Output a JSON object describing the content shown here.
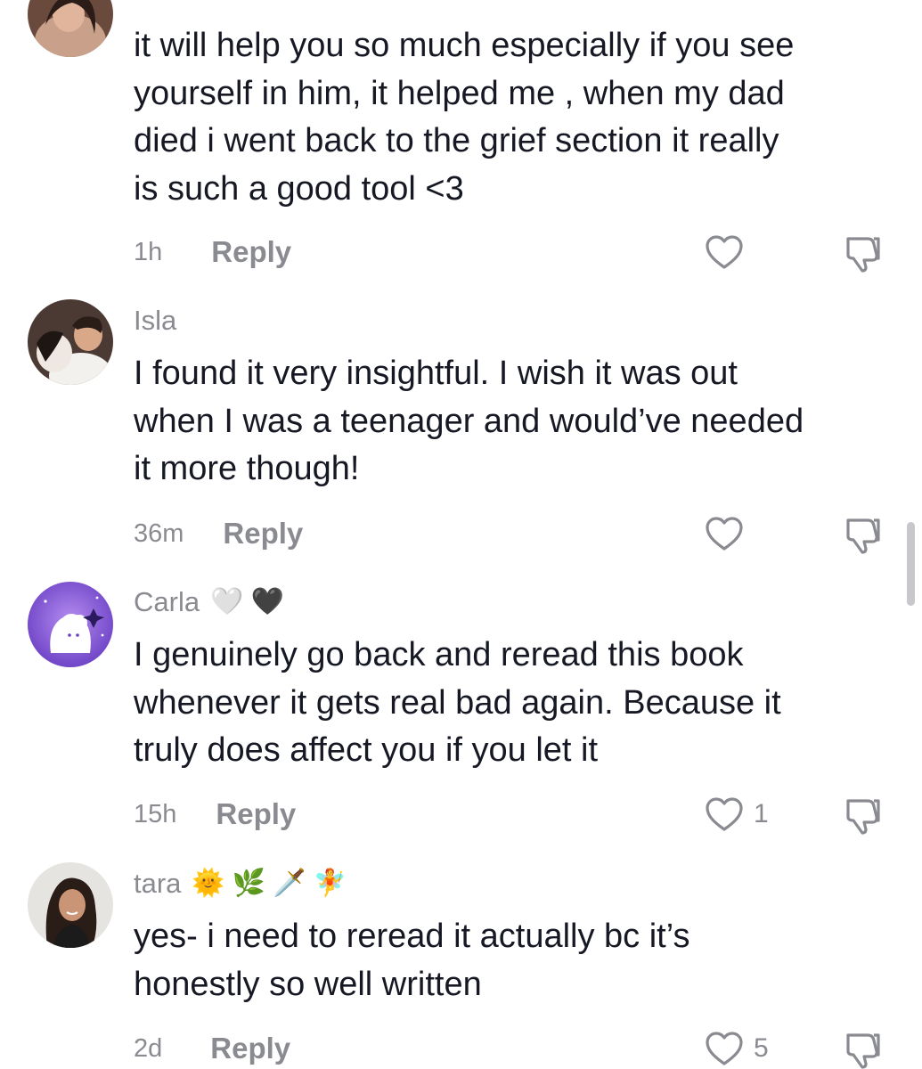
{
  "comments": [
    {
      "username": "",
      "emojis": [],
      "lines": [
        "it will help you so much especially if you see",
        "yourself in him, it helped me , when my dad",
        "died i went back to the grief section it really",
        "is such a good tool <3"
      ],
      "time": "1h",
      "reply_label": "Reply",
      "likes": "",
      "avatar_icon": "profile-photo"
    },
    {
      "username": "Isla",
      "emojis": [],
      "lines": [
        "I found it very insightful. I wish it was out",
        "when I was a teenager and would’ve needed",
        "it more though!"
      ],
      "time": "36m",
      "reply_label": "Reply",
      "likes": "",
      "avatar_icon": "profile-photo"
    },
    {
      "username": "Carla",
      "emojis": [
        "🤍",
        "🖤"
      ],
      "lines": [
        "I genuinely go back and reread this book",
        "whenever it gets real bad again. Because it",
        "truly does affect you if you let it"
      ],
      "time": "15h",
      "reply_label": "Reply",
      "likes": "1",
      "avatar_icon": "cartoon-avatar"
    },
    {
      "username": "tara",
      "emojis": [
        "🌞",
        "🌿",
        "🗡️",
        "🧚"
      ],
      "lines": [
        "yes- i need to reread it actually bc it’s",
        "honestly so well written"
      ],
      "time": "2d",
      "reply_label": "Reply",
      "likes": "5",
      "avatar_icon": "profile-photo"
    }
  ],
  "icons": {
    "like": "heart-outline-icon",
    "dislike": "thumbs-down-icon"
  },
  "colors": {
    "text": "#161823",
    "secondary": "#8a8b91",
    "icon": "#8a8b91"
  }
}
